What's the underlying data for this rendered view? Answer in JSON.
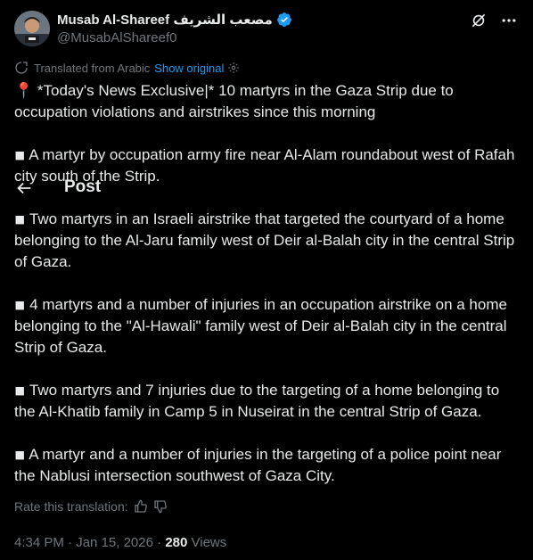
{
  "author": {
    "display_name": "Musab Al-Shareef مصعب الشريف",
    "handle": "@MusabAlShareef0"
  },
  "translation": {
    "notice": "Translated from Arabic",
    "show_original": "Show original"
  },
  "nav": {
    "title": "Post"
  },
  "paragraphs": [
    "📍 *Today's News Exclusive|* 10 martyrs in the Gaza Strip due to occupation violations and airstrikes since this morning",
    "◾ A martyr by occupation army fire near Al-Alam roundabout west of Rafah city south of the Strip.",
    "◾ Two martyrs in an Israeli airstrike that targeted the courtyard of a home belonging to the Al-Jaru family west of Deir al-Balah city in the central Strip of Gaza.",
    "◾ 4 martyrs and a number of injuries in an occupation airstrike on a home belonging to the \"Al-Hawali\" family west of Deir al-Balah city in the central Strip of Gaza.",
    "◾ Two martyrs and 7 injuries due to the targeting of a home belonging to the Al-Khatib family in Camp 5 in Nuseirat in the central Strip of Gaza.",
    "◾ A martyr and a number of injuries in the targeting of a police point near the Nablusi intersection southwest of Gaza City."
  ],
  "rate_translation": "Rate this translation:",
  "meta": {
    "time": "4:34 PM",
    "separator": "·",
    "date": "Jan 15, 2026",
    "views_count": "280",
    "views_label": "Views"
  },
  "colors": {
    "background": "#000000",
    "text": "#e7e9ea",
    "secondary": "#71767b",
    "accent": "#1d9bf0"
  },
  "icons": {
    "verified": "verified-badge-icon",
    "grok": "grok-icon",
    "more": "more-icon",
    "gear": "gear-icon",
    "back": "back-arrow-icon",
    "thumb_up": "thumbs-up-icon",
    "thumb_down": "thumbs-down-icon"
  }
}
